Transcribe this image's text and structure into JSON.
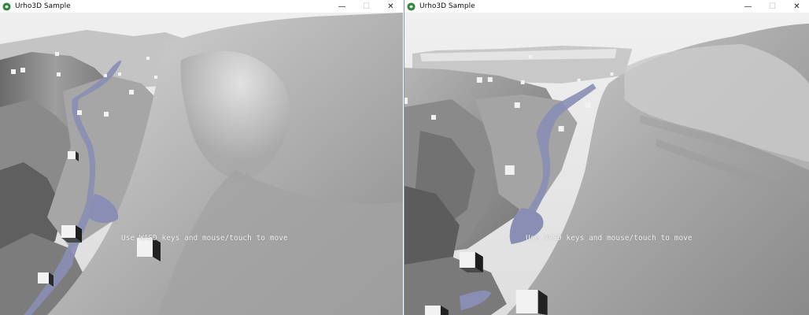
{
  "windows": [
    {
      "title": "Urho3D Sample",
      "icon": "urho3d-logo-icon",
      "controls": {
        "minimize": "—",
        "maximize": "☐",
        "close": "✕"
      },
      "hint": "Use WASD keys and mouse/touch to move"
    },
    {
      "title": "Urho3D Sample",
      "icon": "urho3d-logo-icon",
      "controls": {
        "minimize": "—",
        "maximize": "☐",
        "close": "✕"
      },
      "hint": "Use WASD keys and mouse/touch to move"
    }
  ],
  "colors": {
    "terrain_light": "#d2d2d2",
    "terrain_mid": "#9a9a9a",
    "terrain_dark": "#5a5a5a",
    "water": "#8a8eb4",
    "logo_green": "#2e8b3e"
  }
}
